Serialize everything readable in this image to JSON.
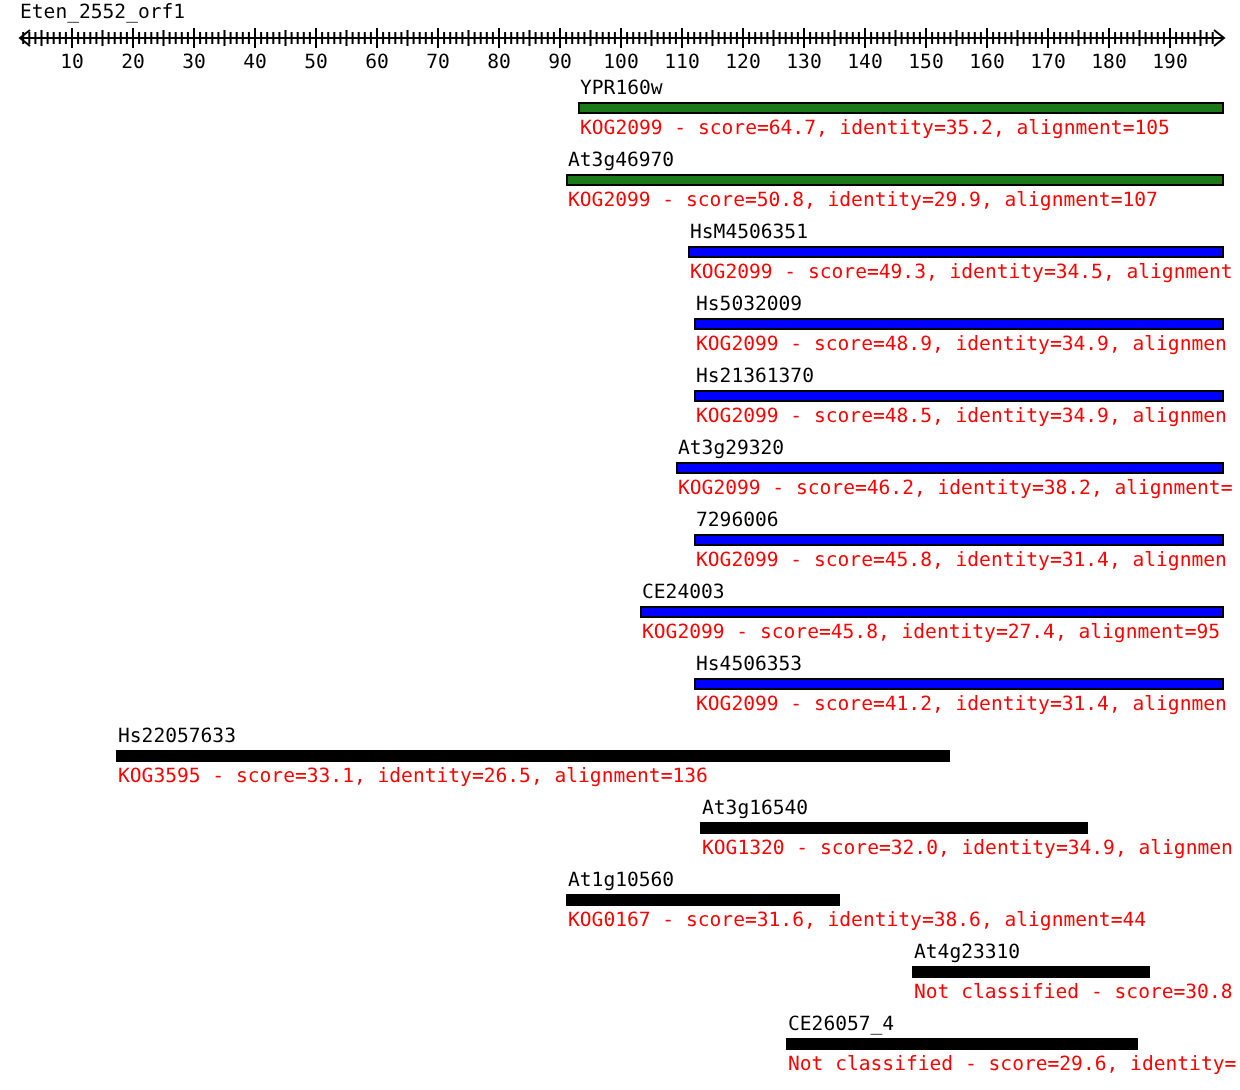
{
  "query": {
    "name": "Eten_2552_orf1"
  },
  "ruler": {
    "ticks": [
      "10",
      "20",
      "30",
      "40",
      "50",
      "60",
      "70",
      "80",
      "90",
      "100",
      "110",
      "120",
      "130",
      "140",
      "150",
      "160",
      "170",
      "180",
      "190"
    ]
  },
  "hits": [
    {
      "name": "YPR160w",
      "color": "#1a7a1a",
      "description": "KOG2099 - score=64.7, identity=35.2, alignment=105"
    },
    {
      "name": "At3g46970",
      "color": "#1a7a1a",
      "description": "KOG2099 - score=50.8, identity=29.9, alignment=107"
    },
    {
      "name": "HsM4506351",
      "color": "#0000ff",
      "description": "KOG2099 - score=49.3, identity=34.5, alignment"
    },
    {
      "name": "Hs5032009",
      "color": "#0000ff",
      "description": "KOG2099 - score=48.9, identity=34.9, alignmen"
    },
    {
      "name": "Hs21361370",
      "color": "#0000ff",
      "description": "KOG2099 - score=48.5, identity=34.9, alignmen"
    },
    {
      "name": "At3g29320",
      "color": "#0000ff",
      "description": "KOG2099 - score=46.2, identity=38.2, alignment="
    },
    {
      "name": "7296006",
      "color": "#0000ff",
      "description": "KOG2099 - score=45.8, identity=31.4, alignmen"
    },
    {
      "name": "CE24003",
      "color": "#0000ff",
      "description": "KOG2099 - score=45.8, identity=27.4, alignment=95"
    },
    {
      "name": "Hs4506353",
      "color": "#0000ff",
      "description": "KOG2099 - score=41.2, identity=31.4, alignmen"
    },
    {
      "name": "Hs22057633",
      "color": "#000000",
      "description": "KOG3595 - score=33.1, identity=26.5, alignment=136"
    },
    {
      "name": "At3g16540",
      "color": "#000000",
      "description": "KOG1320 - score=32.0, identity=34.9, alignmen"
    },
    {
      "name": "At1g10560",
      "color": "#000000",
      "description": "KOG0167 - score=31.6, identity=38.6, alignment=44"
    },
    {
      "name": "At4g23310",
      "color": "#000000",
      "description": "Not classified - score=30.8"
    },
    {
      "name": "CE26057_4",
      "color": "#000000",
      "description": "Not classified - score=29.6, identity="
    }
  ]
}
